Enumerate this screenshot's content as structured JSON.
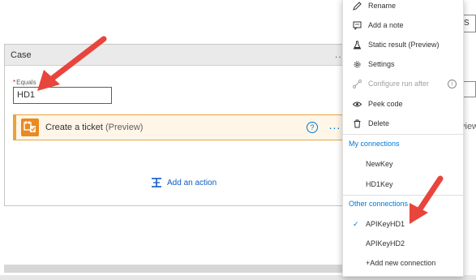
{
  "case": {
    "title": "Case",
    "more_label": "...",
    "equals_required": "*",
    "equals_label": "Equals",
    "equals_value": "HD1"
  },
  "action": {
    "title": "Create a ticket",
    "preview": "(Preview)",
    "help_label": "?",
    "more_label": "..."
  },
  "add_action": {
    "label": "Add an action"
  },
  "peek": {
    "right_button": "S",
    "right_text": "view"
  },
  "menu": {
    "items": [
      {
        "label": "Rename",
        "icon": "pencil-icon"
      },
      {
        "label": "Add a note",
        "icon": "note-icon"
      },
      {
        "label": "Static result (Preview)",
        "icon": "flask-icon"
      },
      {
        "label": "Settings",
        "icon": "gear-icon"
      },
      {
        "label": "Configure run after",
        "icon": "run-after-icon",
        "disabled": true,
        "info": "i"
      },
      {
        "label": "Peek code",
        "icon": "eye-icon"
      },
      {
        "label": "Delete",
        "icon": "trash-icon"
      }
    ],
    "my_connections_heading": "My connections",
    "my_connections": [
      "NewKey",
      "HD1Key"
    ],
    "other_connections_heading": "Other connections",
    "check_mark": "✓",
    "other_connections": [
      {
        "label": "APIKeyHD1",
        "selected": true
      },
      {
        "label": "APIKeyHD2",
        "selected": false
      }
    ],
    "add_connection": "+Add new connection"
  },
  "colors": {
    "accent": "#0078d4",
    "arrow": "#e8453c",
    "action_orange": "#e8a33d"
  }
}
